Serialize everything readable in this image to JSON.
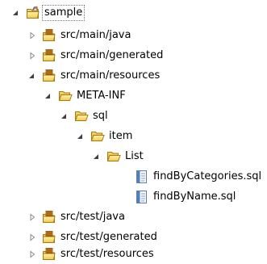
{
  "tree": {
    "root": {
      "label": "sample",
      "icon": "java-project-icon",
      "expanded": true
    },
    "items": [
      {
        "label": "src/main/java",
        "icon": "source-folder-icon",
        "expanded": false
      },
      {
        "label": "src/main/generated",
        "icon": "source-folder-icon",
        "expanded": false
      },
      {
        "label": "src/main/resources",
        "icon": "source-folder-icon",
        "expanded": true
      },
      {
        "label": "META-INF",
        "icon": "folder-open-icon",
        "expanded": true
      },
      {
        "label": "sql",
        "icon": "folder-open-icon",
        "expanded": true
      },
      {
        "label": "item",
        "icon": "folder-open-icon",
        "expanded": true
      },
      {
        "label": "List",
        "icon": "folder-open-icon",
        "expanded": true
      },
      {
        "label": "findByCategories.sql",
        "icon": "sql-file-icon"
      },
      {
        "label": "findByName.sql",
        "icon": "sql-file-icon"
      },
      {
        "label": "src/test/java",
        "icon": "source-folder-icon",
        "expanded": false
      },
      {
        "label": "src/test/generated",
        "icon": "source-folder-icon",
        "expanded": false
      },
      {
        "label": "src/test/resources",
        "icon": "source-folder-icon",
        "expanded": false
      }
    ]
  }
}
